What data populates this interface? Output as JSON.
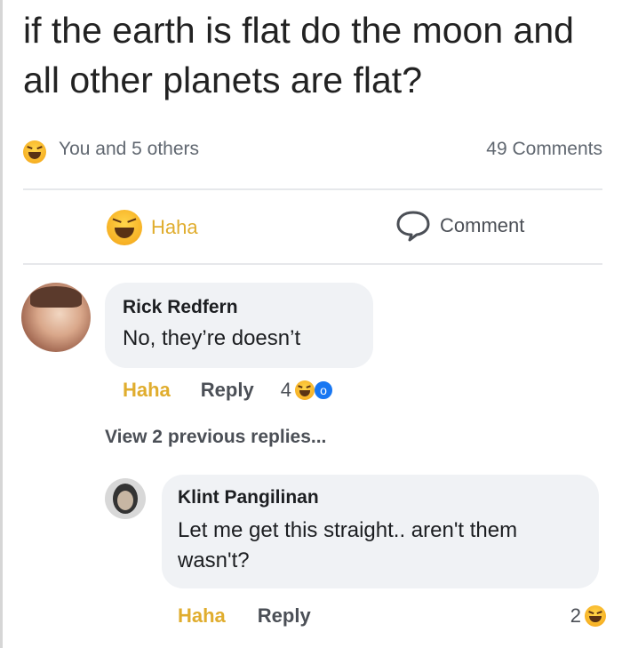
{
  "post": {
    "text": "if the earth is flat do the moon and all other planets are flat?"
  },
  "summary": {
    "reactors": "You and 5 others",
    "comments": "49 Comments"
  },
  "actions": {
    "haha": "Haha",
    "comment": "Comment"
  },
  "comments": [
    {
      "author": "Rick Redfern",
      "text": "No, they’re doesn’t",
      "haha": "Haha",
      "reply": "Reply",
      "reaction_count": "4"
    },
    {
      "author": "Klint Pangilinan",
      "text": "Let me get this straight.. aren't them wasn't?",
      "haha": "Haha",
      "reply": "Reply",
      "reaction_count": "2"
    }
  ],
  "view_previous": "View 2 previous replies...",
  "colors": {
    "haha": "#e0ad2e",
    "secondary_text": "#606770",
    "bubble": "#f0f2f5"
  },
  "icons": [
    "haha-emoji-icon",
    "comment-bubble-icon",
    "wow-emoji-icon",
    "avatar"
  ]
}
